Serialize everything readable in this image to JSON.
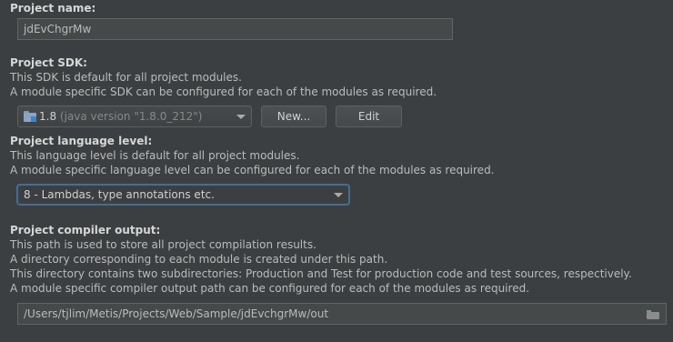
{
  "project_name": {
    "label": "Project name:",
    "value": "jdEvChgrMw"
  },
  "project_sdk": {
    "label": "Project SDK:",
    "desc": [
      "This SDK is default for all project modules.",
      "A module specific SDK can be configured for each of the modules as required."
    ],
    "selected_name": "1.8",
    "selected_version": "(java version \"1.8.0_212\")",
    "new_button": "New...",
    "edit_button": "Edit"
  },
  "language_level": {
    "label": "Project language level:",
    "desc": [
      "This language level is default for all project modules.",
      "A module specific language level can be configured for each of the modules as required."
    ],
    "selected": "8 - Lambdas, type annotations etc."
  },
  "compiler_output": {
    "label": "Project compiler output:",
    "desc": [
      "This path is used to store all project compilation results.",
      "A directory corresponding to each module is created under this path.",
      "This directory contains two subdirectories: Production and Test for production code and test sources, respectively.",
      "A module specific compiler output path can be configured for each of the modules as required."
    ],
    "path": "/Users/tjlim/Metis/Projects/Web/Sample/jdEvchgrMw/out"
  },
  "colors": {
    "background": "#3c3f41",
    "focus_border": "#466d94"
  }
}
